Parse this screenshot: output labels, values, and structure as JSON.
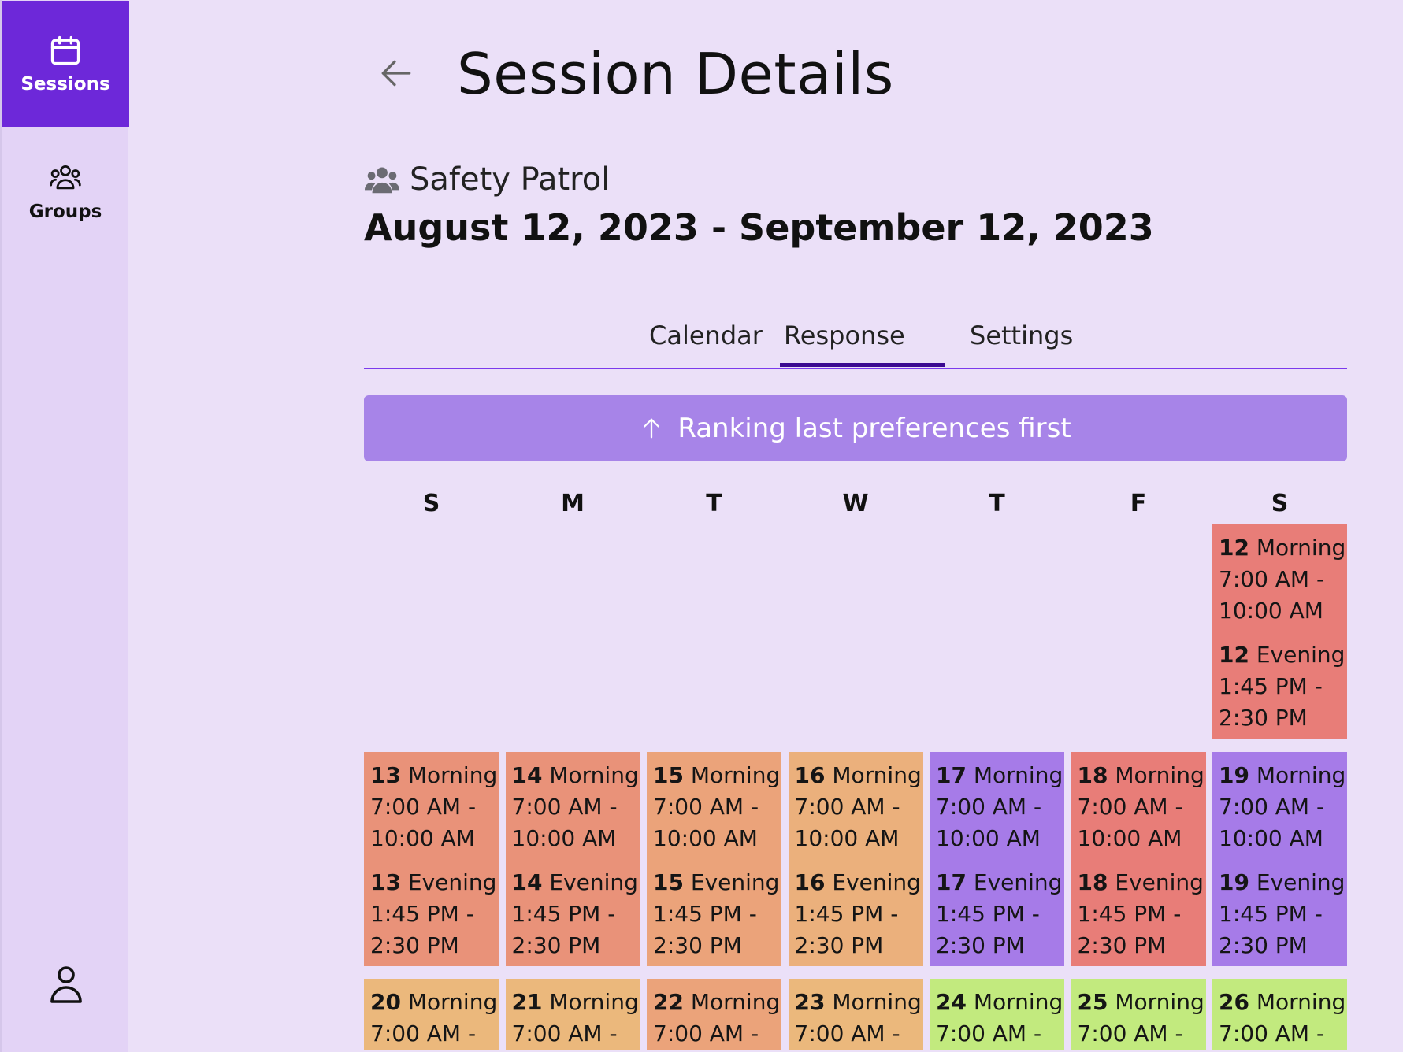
{
  "sidebar": {
    "items": [
      {
        "label": "Sessions",
        "icon": "calendar-icon",
        "active": true
      },
      {
        "label": "Groups",
        "icon": "users-icon",
        "active": false
      }
    ],
    "profile_icon": "user-icon"
  },
  "header": {
    "title": "Session Details",
    "back_icon": "arrow-left-icon"
  },
  "session": {
    "group_name": "Safety Patrol",
    "date_range": "August 12, 2023 - September 12, 2023"
  },
  "tabs": [
    {
      "label": "Calendar"
    },
    {
      "label": "Response",
      "active": true
    },
    {
      "label": "Settings"
    }
  ],
  "ranking_bar": {
    "label": "Ranking last preferences first",
    "icon": "arrow-up-icon"
  },
  "calendar": {
    "weekdays": [
      "S",
      "M",
      "T",
      "W",
      "T",
      "F",
      "S"
    ],
    "colors": {
      "red": "#e87d78",
      "salmon": "#e99279",
      "peach": "#eba37a",
      "light_orange": "#ebb07c",
      "tan": "#ebb87c",
      "purple": "#a67be8",
      "green": "#c2ea7e"
    },
    "slots": [
      {
        "day": "12",
        "name": "Morning",
        "l1": "7:00 AM -",
        "l2": "10:00 AM",
        "col": 6,
        "row": 0,
        "color": "#e87d78"
      },
      {
        "day": "12",
        "name": "Evening",
        "l1": "1:45 PM -",
        "l2": "2:30 PM",
        "col": 6,
        "row": 1,
        "color": "#e87d78"
      },
      {
        "day": "13",
        "name": "Morning",
        "l1": "7:00 AM -",
        "l2": "10:00 AM",
        "col": 0,
        "row": 2,
        "color": "#e99279"
      },
      {
        "day": "14",
        "name": "Morning",
        "l1": "7:00 AM -",
        "l2": "10:00 AM",
        "col": 1,
        "row": 2,
        "color": "#e99279"
      },
      {
        "day": "15",
        "name": "Morning",
        "l1": "7:00 AM -",
        "l2": "10:00 AM",
        "col": 2,
        "row": 2,
        "color": "#eba37a"
      },
      {
        "day": "16",
        "name": "Morning",
        "l1": "7:00 AM -",
        "l2": "10:00 AM",
        "col": 3,
        "row": 2,
        "color": "#ebb07c"
      },
      {
        "day": "17",
        "name": "Morning",
        "l1": "7:00 AM -",
        "l2": "10:00 AM",
        "col": 4,
        "row": 2,
        "color": "#a67be8"
      },
      {
        "day": "18",
        "name": "Morning",
        "l1": "7:00 AM -",
        "l2": "10:00 AM",
        "col": 5,
        "row": 2,
        "color": "#e87d78"
      },
      {
        "day": "19",
        "name": "Morning",
        "l1": "7:00 AM -",
        "l2": "10:00 AM",
        "col": 6,
        "row": 2,
        "color": "#a67be8"
      },
      {
        "day": "13",
        "name": "Evening",
        "l1": "1:45 PM -",
        "l2": "2:30 PM",
        "col": 0,
        "row": 3,
        "color": "#e99279"
      },
      {
        "day": "14",
        "name": "Evening",
        "l1": "1:45 PM -",
        "l2": "2:30 PM",
        "col": 1,
        "row": 3,
        "color": "#e99279"
      },
      {
        "day": "15",
        "name": "Evening",
        "l1": "1:45 PM -",
        "l2": "2:30 PM",
        "col": 2,
        "row": 3,
        "color": "#eba37a"
      },
      {
        "day": "16",
        "name": "Evening",
        "l1": "1:45 PM -",
        "l2": "2:30 PM",
        "col": 3,
        "row": 3,
        "color": "#ebb07c"
      },
      {
        "day": "17",
        "name": "Evening",
        "l1": "1:45 PM -",
        "l2": "2:30 PM",
        "col": 4,
        "row": 3,
        "color": "#a67be8"
      },
      {
        "day": "18",
        "name": "Evening",
        "l1": "1:45 PM -",
        "l2": "2:30 PM",
        "col": 5,
        "row": 3,
        "color": "#e87d78"
      },
      {
        "day": "19",
        "name": "Evening",
        "l1": "1:45 PM -",
        "l2": "2:30 PM",
        "col": 6,
        "row": 3,
        "color": "#a67be8"
      },
      {
        "day": "20",
        "name": "Morning",
        "l1": "7:00 AM -",
        "l2": "",
        "col": 0,
        "row": 4,
        "color": "#ebb87c"
      },
      {
        "day": "21",
        "name": "Morning",
        "l1": "7:00 AM -",
        "l2": "",
        "col": 1,
        "row": 4,
        "color": "#ebb87c"
      },
      {
        "day": "22",
        "name": "Morning",
        "l1": "7:00 AM -",
        "l2": "",
        "col": 2,
        "row": 4,
        "color": "#eba37a"
      },
      {
        "day": "23",
        "name": "Morning",
        "l1": "7:00 AM -",
        "l2": "",
        "col": 3,
        "row": 4,
        "color": "#ebb87c"
      },
      {
        "day": "24",
        "name": "Morning",
        "l1": "7:00 AM -",
        "l2": "",
        "col": 4,
        "row": 4,
        "color": "#c2ea7e"
      },
      {
        "day": "25",
        "name": "Morning",
        "l1": "7:00 AM -",
        "l2": "",
        "col": 5,
        "row": 4,
        "color": "#c2ea7e"
      },
      {
        "day": "26",
        "name": "Morning",
        "l1": "7:00 AM -",
        "l2": "",
        "col": 6,
        "row": 4,
        "color": "#c2ea7e"
      }
    ]
  }
}
